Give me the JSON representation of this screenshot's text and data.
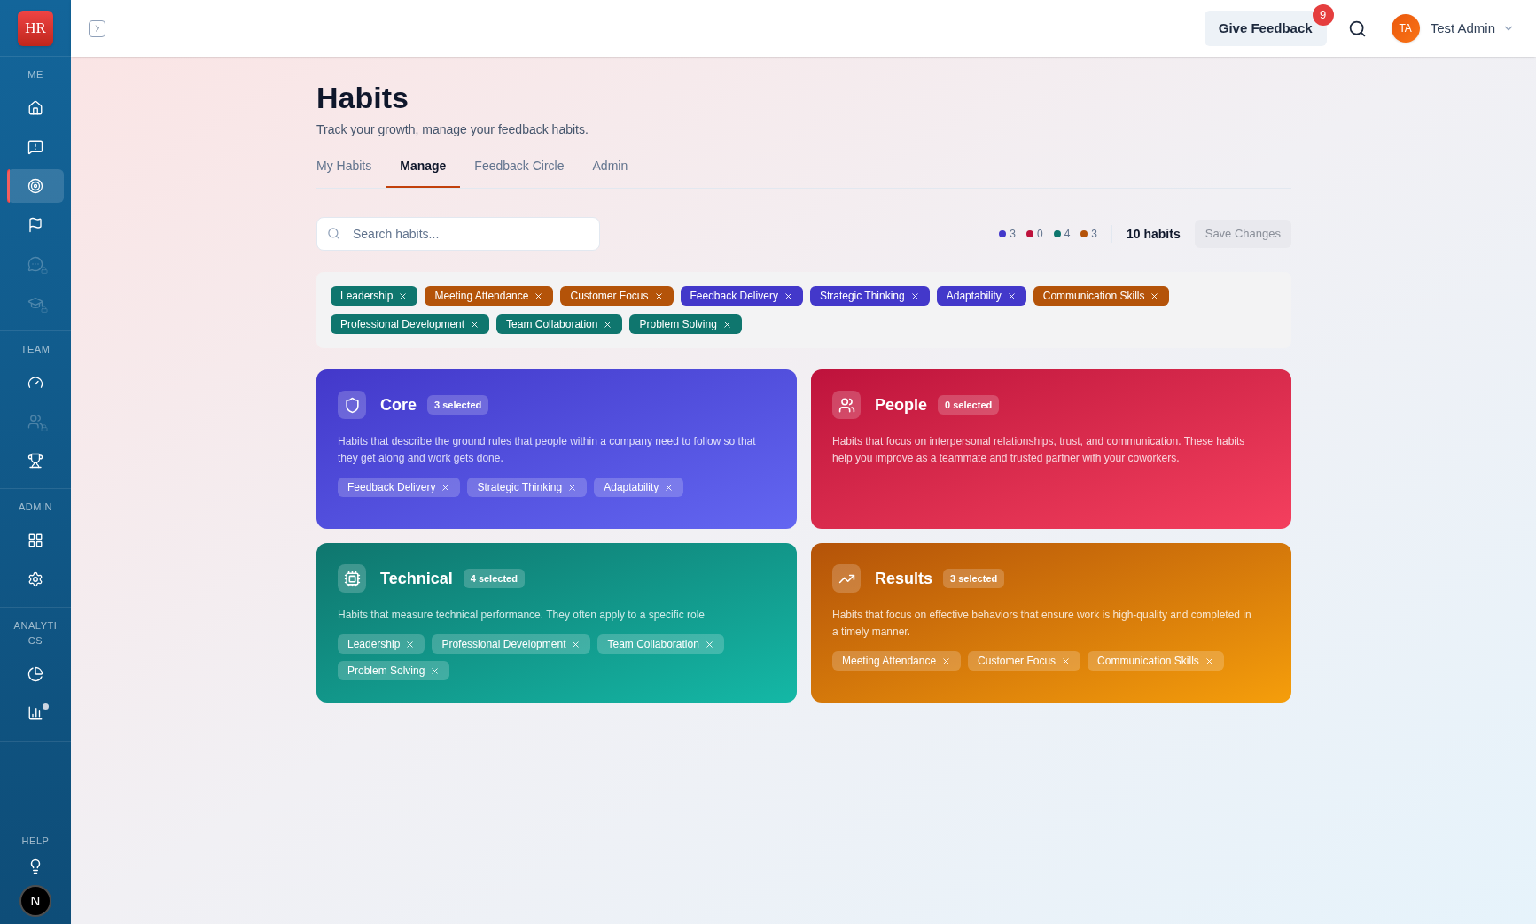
{
  "sidebar": {
    "logo": "HR",
    "sections": [
      {
        "label": "ME",
        "items": [
          {
            "selected": false,
            "locked": false,
            "dot": false
          },
          {
            "selected": false,
            "locked": false,
            "dot": false
          },
          {
            "selected": true,
            "locked": false,
            "dot": false
          },
          {
            "selected": false,
            "locked": false,
            "dot": false
          },
          {
            "selected": false,
            "locked": true,
            "dot": false
          },
          {
            "selected": false,
            "locked": true,
            "dot": false
          }
        ]
      },
      {
        "label": "TEAM",
        "items": [
          {
            "selected": false,
            "locked": false,
            "dot": false
          },
          {
            "selected": false,
            "locked": true,
            "dot": false
          },
          {
            "selected": false,
            "locked": false,
            "dot": false
          }
        ]
      },
      {
        "label": "ADMIN",
        "items": [
          {
            "selected": false,
            "locked": false,
            "dot": false
          },
          {
            "selected": false,
            "locked": false,
            "dot": false
          }
        ]
      },
      {
        "label": "ANALYTICS",
        "items": [
          {
            "selected": false,
            "locked": false,
            "dot": false
          },
          {
            "selected": false,
            "locked": false,
            "dot": true
          }
        ]
      }
    ],
    "help": {
      "label": "HELP"
    },
    "avatar": "N"
  },
  "header": {
    "give_feedback": "Give Feedback",
    "notification_count": "9",
    "user": {
      "initials": "TA",
      "name": "Test Admin"
    }
  },
  "page": {
    "title": "Habits",
    "subtitle": "Track your growth, manage your feedback habits."
  },
  "tabs": [
    {
      "label": "My Habits",
      "selected": false
    },
    {
      "label": "Manage",
      "selected": true
    },
    {
      "label": "Feedback Circle",
      "selected": false
    },
    {
      "label": "Admin",
      "selected": false
    }
  ],
  "search": {
    "placeholder": "Search habits..."
  },
  "legend": [
    {
      "color": "#4338ca",
      "count": "3"
    },
    {
      "color": "#be123c",
      "count": "0"
    },
    {
      "color": "#0f766e",
      "count": "4"
    },
    {
      "color": "#b45309",
      "count": "3"
    }
  ],
  "habit_count": "10 habits",
  "save_button": {
    "label": "Save Changes",
    "disabled": true
  },
  "selected_habits": [
    {
      "label": "Leadership",
      "color": "#0f766e"
    },
    {
      "label": "Meeting Attendance",
      "color": "#b45309"
    },
    {
      "label": "Customer Focus",
      "color": "#b45309"
    },
    {
      "label": "Feedback Delivery",
      "color": "#4338ca"
    },
    {
      "label": "Strategic Thinking",
      "color": "#4338ca"
    },
    {
      "label": "Adaptability",
      "color": "#4338ca"
    },
    {
      "label": "Communication Skills",
      "color": "#b45309"
    },
    {
      "label": "Professional Development",
      "color": "#0f766e"
    },
    {
      "label": "Team Collaboration",
      "color": "#0f766e"
    },
    {
      "label": "Problem Solving",
      "color": "#0f766e"
    }
  ],
  "categories": [
    {
      "kind": "core",
      "title": "Core",
      "badge": "3 selected",
      "description": "Habits that describe the ground rules that people within a company need to follow so that they get along and work gets done.",
      "habits": [
        "Feedback Delivery",
        "Strategic Thinking",
        "Adaptability"
      ]
    },
    {
      "kind": "people",
      "title": "People",
      "badge": "0 selected",
      "description": "Habits that focus on interpersonal relationships, trust, and communication. These habits help you improve as a teammate and trusted partner with your coworkers."
    },
    {
      "kind": "technical",
      "title": "Technical",
      "badge": "4 selected",
      "description": "Habits that measure technical performance. They often apply to a specific role",
      "habits": [
        "Leadership",
        "Professional Development",
        "Team Collaboration",
        "Problem Solving"
      ]
    },
    {
      "kind": "results",
      "title": "Results",
      "badge": "3 selected",
      "description": "Habits that focus on effective behaviors that ensure work is high-quality and completed in a timely manner.",
      "habits": [
        "Meeting Attendance",
        "Customer Focus",
        "Communication Skills"
      ]
    }
  ]
}
